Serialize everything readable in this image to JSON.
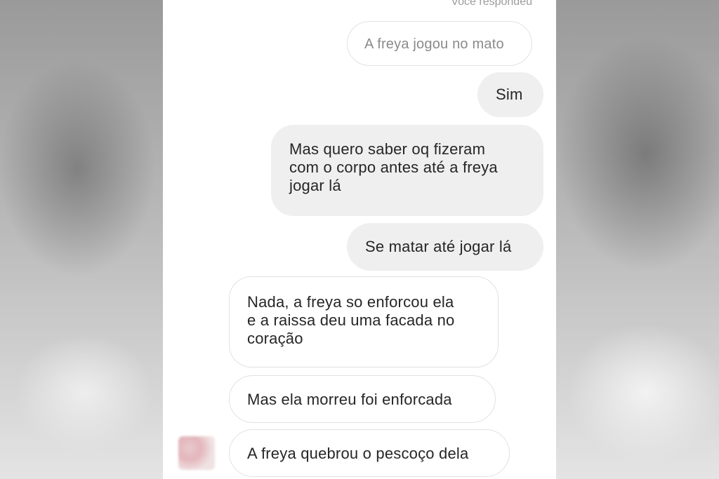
{
  "thread": {
    "replied_label": "Você respondeu",
    "replied_to": "A freya jogou no mato",
    "messages": [
      {
        "direction": "sent",
        "text": "Sim"
      },
      {
        "direction": "sent",
        "text": "Mas quero saber oq fizeram\ncom o corpo antes até a freya\njogar lá"
      },
      {
        "direction": "sent",
        "text": "Se matar até jogar lá"
      },
      {
        "direction": "received",
        "text": "Nada, a freya so enforcou ela\ne a raissa deu uma facada no\ncoração"
      },
      {
        "direction": "received",
        "text": "Mas ela morreu foi enforcada"
      },
      {
        "direction": "received",
        "text": "A freya quebrou o pescoço dela"
      }
    ]
  },
  "colors": {
    "sent_bubble": "#efefef",
    "received_bubble": "#ffffff",
    "text": "#262626",
    "muted_text": "#9b9b9b"
  }
}
